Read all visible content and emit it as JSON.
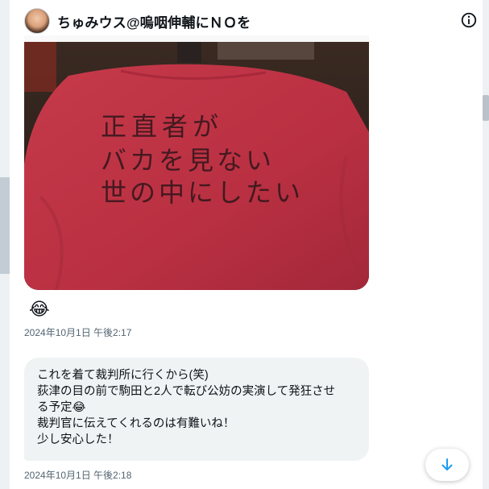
{
  "header": {
    "title": "ちゅみウス@嗚咽伸輔にＮＯを"
  },
  "icons": {
    "info": "info-icon",
    "scroll_down": "arrow-down-icon"
  },
  "messages": [
    {
      "type": "image",
      "image_text_lines": [
        "正直者が",
        "バカを見ない",
        "世の中にしたい"
      ],
      "reaction": "😂",
      "timestamp": "2024年10月1日 午後2:17"
    },
    {
      "type": "text",
      "lines": [
        "これを着て裁判所に行くから(笑)",
        "荻津の目の前で駒田と2人で転び公妨の実演して発狂させ",
        "る予定😂",
        "裁判官に伝えてくれるのは有難いね！",
        "少し安心した！"
      ],
      "timestamp": "2024年10月1日 午後2:18"
    }
  ],
  "colors": {
    "accent": "#1d9bf0",
    "bubble": "#eff3f4",
    "shirt": "#c7384a"
  }
}
